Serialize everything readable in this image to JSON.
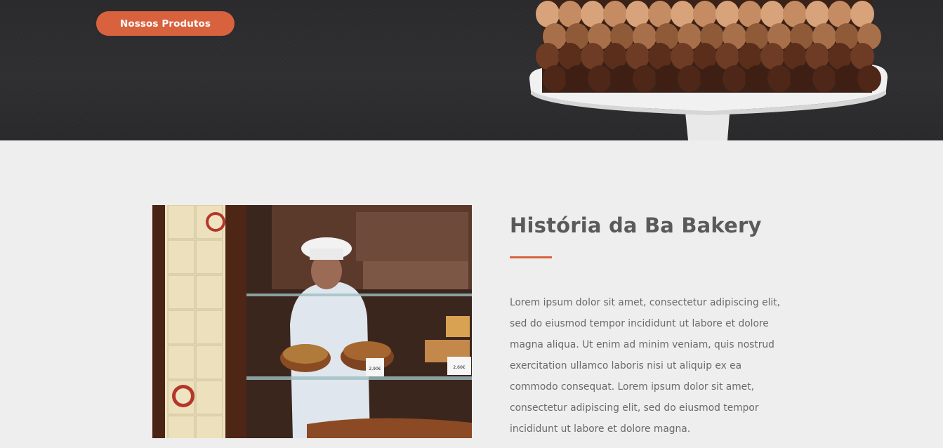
{
  "hero": {
    "cta_label": "Nossos Produtos",
    "accent": "#d9623e",
    "background": "#2e2d2f",
    "image_subject": "chocolate-frosted-cake-on-white-stand"
  },
  "about": {
    "title": "História da Ba Bakery",
    "accent": "#d9623e",
    "paragraph": "Lorem ipsum dolor sit amet, consectetur adipiscing elit, sed do eiusmod tempor incididunt ut labore et dolore magna aliqua. Ut enim ad minim veniam, quis nostrud exercitation ullamco laboris nisi ut aliquip ex ea commodo consequat. Lorem ipsum dolor sit amet, consectetur adipiscing elit, sed do eiusmod tempor incididunt ut labore et dolore magna.",
    "image_subject": "baker-behind-bakery-display-window",
    "price_tags": [
      "2,90€",
      "2,60€"
    ]
  }
}
